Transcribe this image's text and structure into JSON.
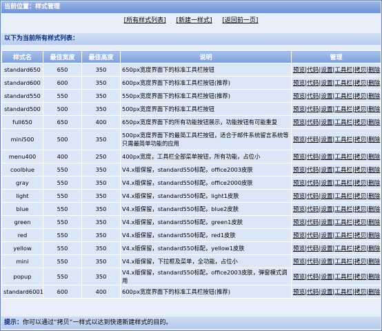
{
  "header": {
    "title": "当前位置：样式管理"
  },
  "toolbar": {
    "links": [
      "[所有样式列表]",
      "[新建一样式]",
      "[返回前一页]"
    ]
  },
  "list_header": "以下为当前所有样式列表：",
  "table": {
    "columns": [
      "样式名",
      "最佳宽度",
      "最佳高度",
      "说明",
      "管理"
    ],
    "ops": [
      "预览",
      "代码",
      "设置",
      "工具栏",
      "拷贝",
      "删除"
    ],
    "rows": [
      {
        "name": "standard650",
        "w": "650",
        "h": "350",
        "desc": "650px宽度界面下的标准工具栏按钮"
      },
      {
        "name": "standard600",
        "w": "600",
        "h": "350",
        "desc": "600px宽度界面下的标准工具栏按钮(推荐)"
      },
      {
        "name": "standard550",
        "w": "550",
        "h": "350",
        "desc": "550px宽度界面下的标准工具栏按钮(推荐)"
      },
      {
        "name": "standard500",
        "w": "500",
        "h": "350",
        "desc": "500px宽度界面下的标准工具栏按钮"
      },
      {
        "name": "full650",
        "w": "650",
        "h": "400",
        "desc": "650px宽度界面下的所有功能按钮展示，功能按钮有可能重复"
      },
      {
        "name": "mini500",
        "w": "500",
        "h": "350",
        "desc": "500px宽度界面下的最简工具栏按钮，适合于邮件系统留言系统等只需最简单功能的应用",
        "tall": true
      },
      {
        "name": "menu400",
        "w": "400",
        "h": "250",
        "desc": "400px宽度，工具栏全部菜单按钮，所有功能，占位小"
      },
      {
        "name": "coolblue",
        "w": "550",
        "h": "350",
        "desc": "V4.x版保留，standard550标配，office2003皮肤"
      },
      {
        "name": "gray",
        "w": "550",
        "h": "350",
        "desc": "V4.x版保留，standard550标配，office2000皮肤"
      },
      {
        "name": "light",
        "w": "550",
        "h": "350",
        "desc": "V4.x版保留，standard550标配，light1皮肤"
      },
      {
        "name": "blue",
        "w": "550",
        "h": "350",
        "desc": "V4.x版保留，standard550标配，blue2皮肤"
      },
      {
        "name": "green",
        "w": "550",
        "h": "350",
        "desc": "V4.x版保留，standard550标配，green1皮肤"
      },
      {
        "name": "red",
        "w": "550",
        "h": "350",
        "desc": "V4.x版保留，standard550标配，red1皮肤"
      },
      {
        "name": "yellow",
        "w": "550",
        "h": "350",
        "desc": "V4.x版保留，standard550标配，yellow1皮肤"
      },
      {
        "name": "mini",
        "w": "550",
        "h": "350",
        "desc": "V4.x版保留，下拉框及菜单，全功能，占位小"
      },
      {
        "name": "popup",
        "w": "550",
        "h": "350",
        "desc": "V4.x版保留，standard550标配，office2003皮肤，弹窗模式调用"
      },
      {
        "name": "standard6001",
        "w": "600",
        "h": "400",
        "desc": "600px宽度界面下的标准工具栏按钮(推荐)"
      }
    ]
  },
  "tip": {
    "label": "提示：",
    "text": "你可以通过“拷贝”一样式以达到快速新建样式的目的。"
  }
}
